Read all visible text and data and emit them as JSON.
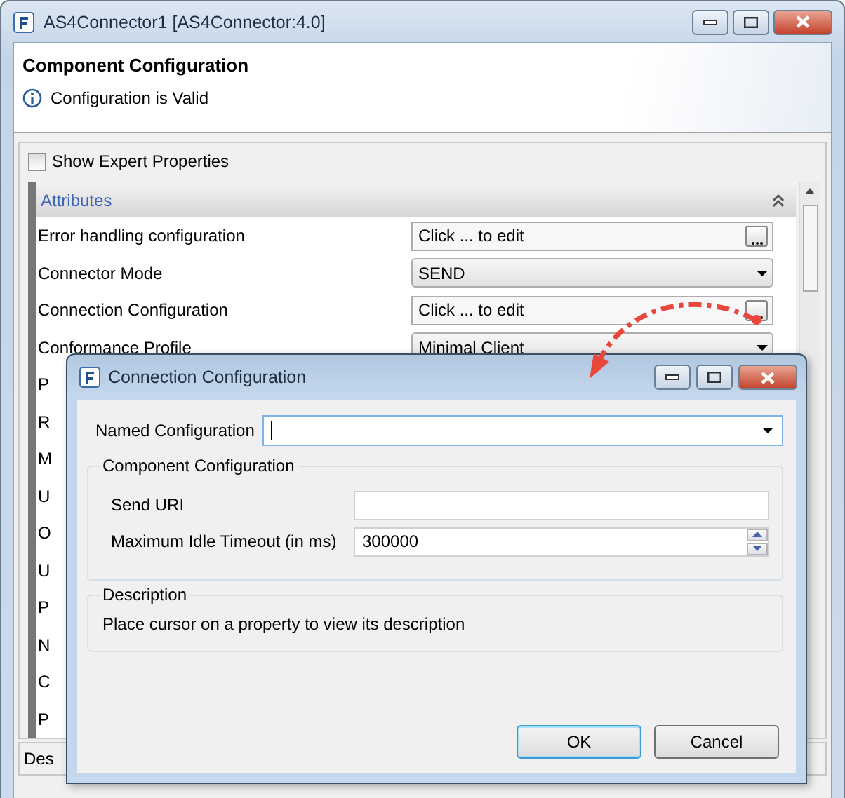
{
  "window": {
    "title": "AS4Connector1 [AS4Connector:4.0]"
  },
  "header": {
    "title": "Component Configuration",
    "message": "Configuration is Valid"
  },
  "expert_toggle": {
    "label": "Show Expert Properties",
    "checked": false
  },
  "attributes": {
    "title": "Attributes",
    "expanded": true,
    "rows": [
      {
        "label": "Error handling configuration",
        "kind": "editor",
        "value": "Click ... to edit"
      },
      {
        "label": "Connector Mode",
        "kind": "select",
        "value": "SEND"
      },
      {
        "label": "Connection Configuration",
        "kind": "editor",
        "value": "Click ... to edit"
      },
      {
        "label": "Conformance Profile",
        "kind": "select",
        "value": "Minimal Client"
      },
      {
        "label": "P",
        "kind": "covered"
      },
      {
        "label": "R",
        "kind": "covered"
      },
      {
        "label": "M",
        "kind": "covered"
      },
      {
        "label": "U",
        "kind": "covered"
      },
      {
        "label": "O",
        "kind": "covered"
      },
      {
        "label": "U",
        "kind": "covered"
      },
      {
        "label": "P",
        "kind": "covered"
      },
      {
        "label": "N",
        "kind": "covered"
      },
      {
        "label": "C",
        "kind": "covered"
      },
      {
        "label": "P",
        "kind": "covered"
      }
    ]
  },
  "description_panel": {
    "title": "Des"
  },
  "dialog": {
    "title": "Connection Configuration",
    "named_configuration": {
      "label": "Named Configuration"
    },
    "group": {
      "title": "Component Configuration",
      "fields": [
        {
          "label": "Send URI",
          "kind": "text"
        },
        {
          "label": "Maximum Idle Timeout (in ms)",
          "kind": "spinner",
          "value": "300000"
        }
      ]
    },
    "description": {
      "title": "Description",
      "text": "Place cursor on a property to view its description"
    },
    "buttons": [
      {
        "label": "OK",
        "default": true
      },
      {
        "label": "Cancel",
        "default": false
      }
    ]
  }
}
